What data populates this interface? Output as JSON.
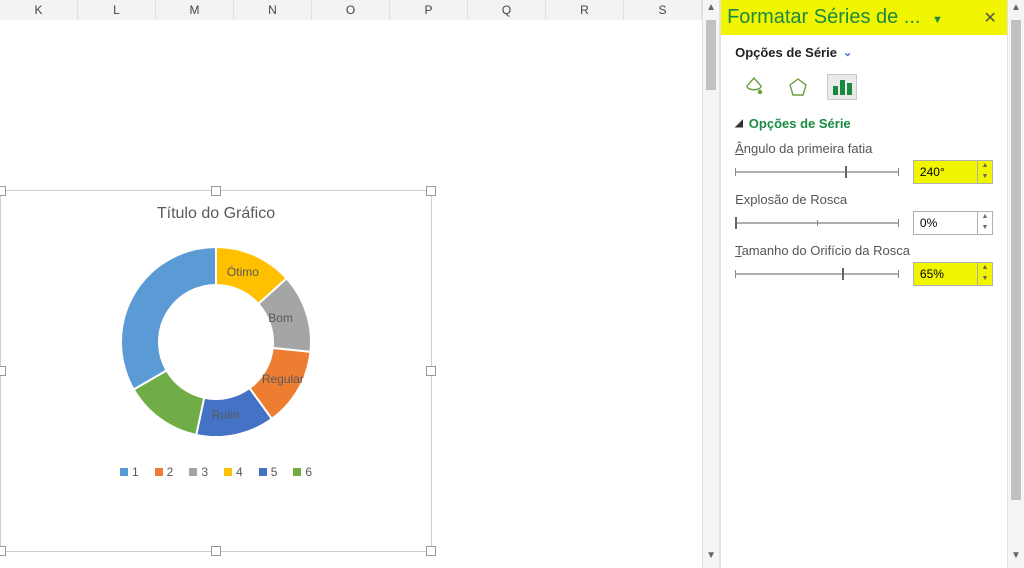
{
  "columns": [
    "K",
    "L",
    "M",
    "N",
    "O",
    "P",
    "Q",
    "R",
    "S"
  ],
  "panel": {
    "title": "Formatar Séries de ...",
    "options_header": "Opções de Série",
    "series_options_title": "Opções de Série",
    "angle": {
      "label": "Ângulo da primeira fatia",
      "value": "240°",
      "pos_pct": 67
    },
    "explosion": {
      "label": "Explosão de Rosca",
      "value": "0%",
      "pos_pct": 0
    },
    "hole": {
      "label": "Tamanho do Orifício da Rosca",
      "value": "65%",
      "pos_pct": 65
    }
  },
  "chart": {
    "title": "Título do Gráfico",
    "legend": [
      "1",
      "2",
      "3",
      "4",
      "5",
      "6"
    ],
    "colors": [
      "#5b9bd5",
      "#ed7d31",
      "#a5a5a5",
      "#ffc000",
      "#4472c4",
      "#70ad47"
    ],
    "segments": [
      {
        "label": "",
        "angle": 120,
        "color": "#5b9bd5"
      },
      {
        "label": "Ótimo",
        "angle": 48,
        "color": "#ffc000"
      },
      {
        "label": "Bom",
        "angle": 48,
        "color": "#a5a5a5"
      },
      {
        "label": "Regular",
        "angle": 48,
        "color": "#ed7d31"
      },
      {
        "label": "Ruim",
        "angle": 48,
        "color": "#4472c4"
      },
      {
        "label": "",
        "angle": 48,
        "color": "#70ad47"
      }
    ]
  },
  "chart_data": {
    "type": "pie",
    "title": "Título do Gráfico",
    "start_angle_deg": 240,
    "donut_hole_pct": 65,
    "categories": [
      "1",
      "2",
      "3",
      "4",
      "5",
      "6"
    ],
    "values": [
      2,
      1,
      1,
      1,
      1,
      1
    ],
    "labels": [
      "",
      "Ótimo",
      "Bom",
      "Regular",
      "Ruim",
      ""
    ],
    "colors": [
      "#5b9bd5",
      "#ed7d31",
      "#a5a5a5",
      "#ffc000",
      "#4472c4",
      "#70ad47"
    ]
  }
}
